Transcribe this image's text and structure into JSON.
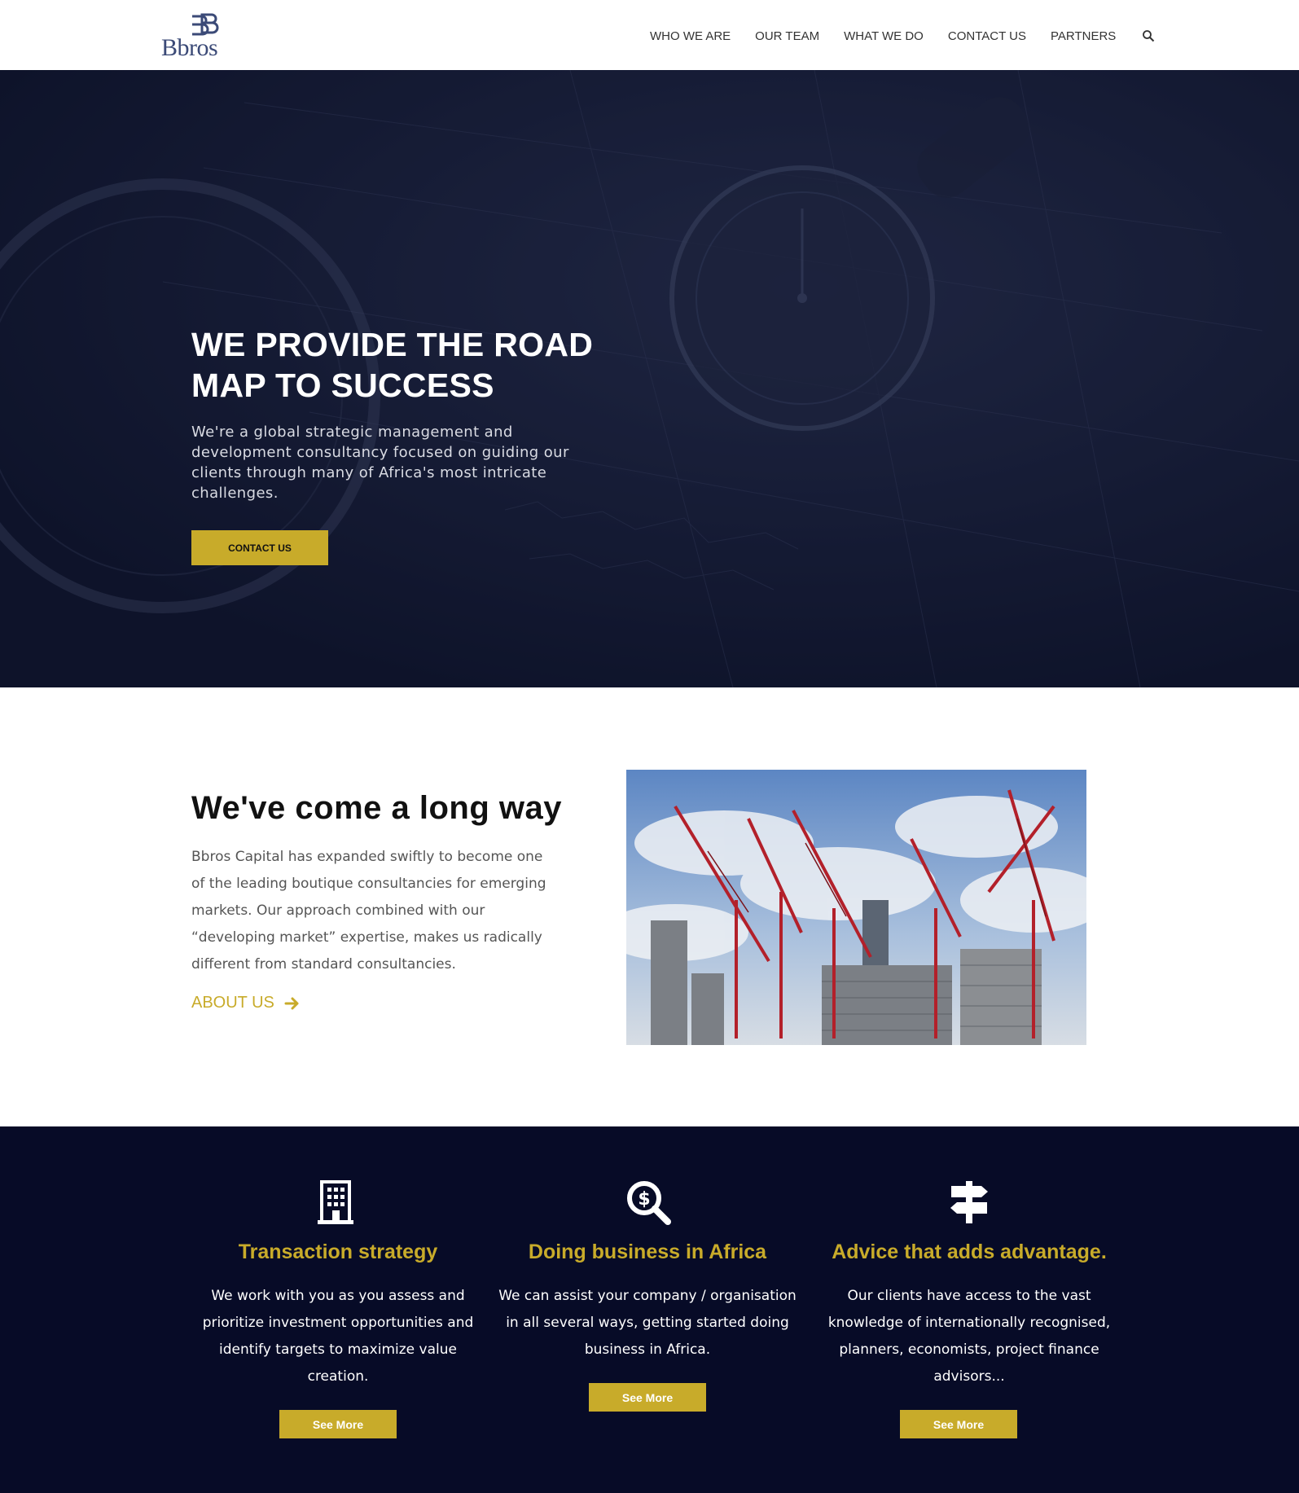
{
  "brand": {
    "logo_text": "Bbros",
    "logo_mark": "SB"
  },
  "nav": {
    "items": [
      "WHO WE ARE",
      "OUR TEAM",
      "WHAT WE DO",
      "CONTACT US",
      "PARTNERS"
    ],
    "search_icon": "search-icon"
  },
  "hero": {
    "title_line1": "WE PROVIDE THE ROAD",
    "title_line2": "MAP TO SUCCESS",
    "description": "We're a global strategic management and development consultancy focused on guiding our clients through many of Africa's most intricate challenges.",
    "button_label": "CONTACT US"
  },
  "about": {
    "title": "We've come a long way",
    "text": "Bbros Capital has expanded swiftly to become one of the leading boutique consultancies for emerging markets. Our approach combined with our “developing market” expertise, makes us radically different from standard consultancies.",
    "link_label": "ABOUT US",
    "link_icon": "arrow-right-icon",
    "image_subject": "construction cranes over buildings"
  },
  "services": [
    {
      "icon": "building-icon",
      "title": "Transaction strategy",
      "text": "We work with you as you assess and prioritize investment opportunities and identify targets to maximize value creation.",
      "button_label": "See More"
    },
    {
      "icon": "dollar-search-icon",
      "title": "Doing business in Africa",
      "text": "We can assist your company / organisation in all several ways, getting started doing business in Africa.",
      "button_label": "See More"
    },
    {
      "icon": "signpost-icon",
      "title": "Advice that adds advantage.",
      "text": "Our clients have access to the vast knowledge of internationally recognised, planners, economists, project finance advisors...",
      "button_label": "See More"
    }
  ],
  "colors": {
    "accent": "#c8ab2a",
    "navy": "#070b27",
    "hero_overlay": "#141a33",
    "logo": "#3b4a77"
  }
}
